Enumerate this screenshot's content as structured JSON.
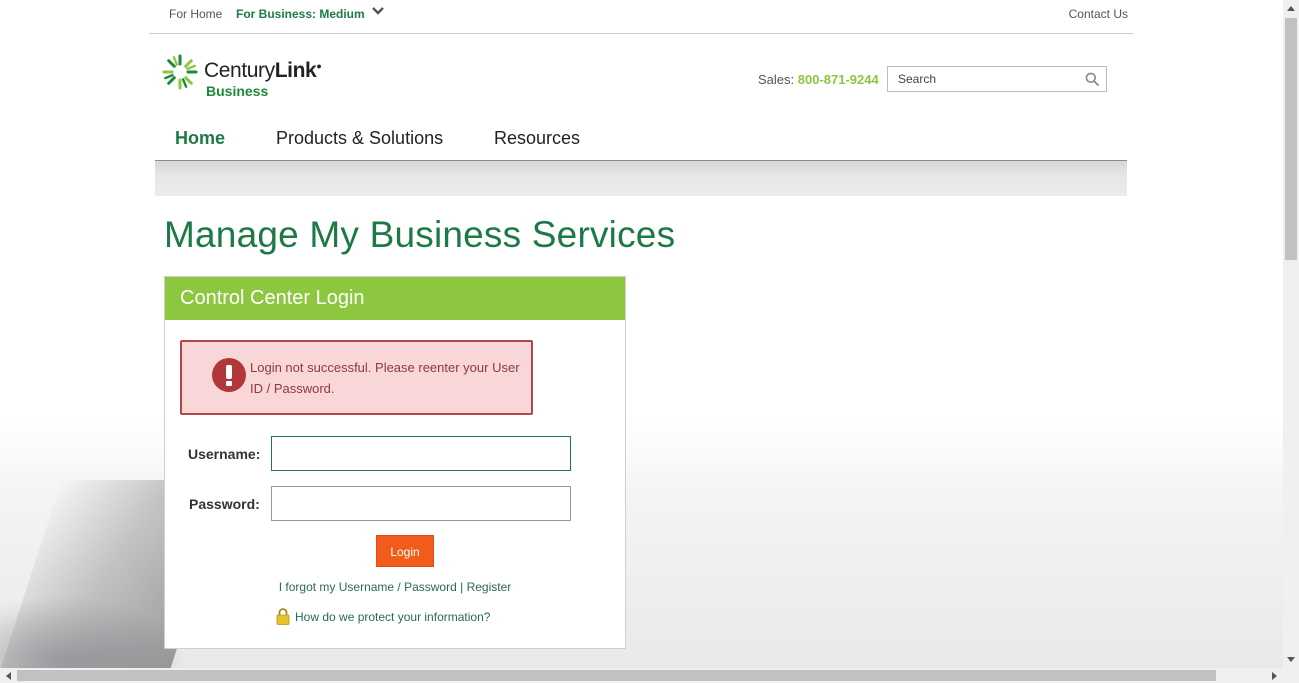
{
  "utility": {
    "for_home": "For Home",
    "for_business": "For Business: Medium",
    "contact_us": "Contact Us"
  },
  "brand": {
    "name_regular": "Century",
    "name_bold": "Link",
    "sub": "Business",
    "green": "#1d7a46",
    "lime": "#8dc63f"
  },
  "header": {
    "sales_label": "Sales:",
    "sales_phone": "800-871-9244",
    "search_placeholder": "Search"
  },
  "nav": {
    "items": [
      {
        "label": "Home",
        "active": true
      },
      {
        "label": "Products & Solutions",
        "active": false
      },
      {
        "label": "Resources",
        "active": false
      }
    ]
  },
  "page": {
    "title": "Manage My Business Services"
  },
  "login": {
    "panel_title": "Control Center Login",
    "error_message": "Login not successful. Please reenter your User ID / Password.",
    "username_label": "Username:",
    "username_value": "",
    "password_label": "Password:",
    "password_value": "",
    "login_button": "Login",
    "forgot_link": "I forgot my Username / Password",
    "separator": "|",
    "register_link": "Register",
    "protect_link": "How do we protect your information?",
    "button_color": "#f25c1a",
    "error_color": "#b03838"
  }
}
